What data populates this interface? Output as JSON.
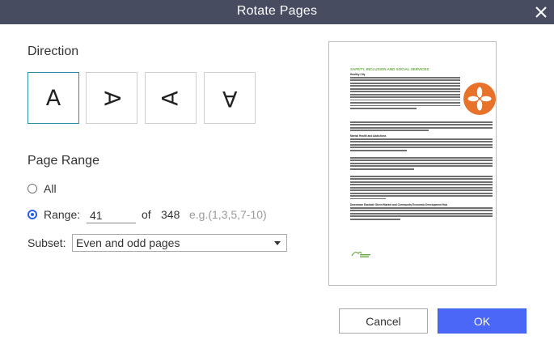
{
  "dialog": {
    "title": "Rotate Pages"
  },
  "direction": {
    "label": "Direction",
    "options": [
      {
        "glyph": "A",
        "rotation": 0,
        "selected": true
      },
      {
        "glyph": "A",
        "rotation": 90,
        "selected": false
      },
      {
        "glyph": "A",
        "rotation": 270,
        "selected": false
      },
      {
        "glyph": "A",
        "rotation": 180,
        "selected": false
      }
    ]
  },
  "page_range": {
    "label": "Page Range",
    "all_label": "All",
    "range_label": "Range:",
    "range_value": "41",
    "of_label": "of",
    "total_pages": "348",
    "example_hint": "e.g.(1,3,5,7-10)",
    "selected_option": "range"
  },
  "subset": {
    "label": "Subset:",
    "value": "Even and odd pages"
  },
  "preview": {
    "heading": "SAFETY, INCLUSION AND SOCIAL SERVICES",
    "subheads": [
      "Healthy City",
      "Mental Health and Addictions",
      "Downtown Eastside Street Market and Community Economic Development Hub"
    ],
    "logo_color": "#e8722a",
    "heading_color": "#6aa844"
  },
  "buttons": {
    "cancel": "Cancel",
    "ok": "OK"
  },
  "colors": {
    "titlebar": "#474c60",
    "accent": "#4a68f5",
    "selected_border": "#2e8fa3"
  }
}
